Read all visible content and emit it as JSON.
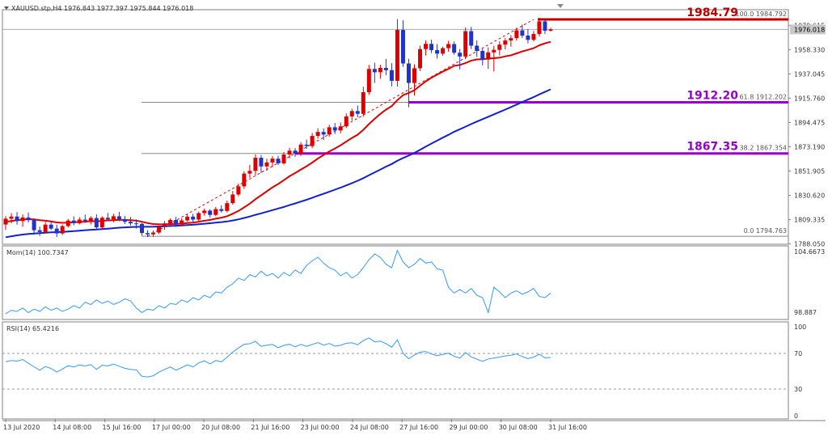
{
  "price_panel": {
    "title": "XAUUSD.stp,H4  1976.843 1977.397 1975.844 1976.018",
    "price_ticks": [
      "1979.615",
      "1958.330",
      "1937.045",
      "1915.760",
      "1894.475",
      "1873.190",
      "1851.905",
      "1830.620",
      "1809.335",
      "1788.050"
    ],
    "current_price": "1976.018",
    "fib": [
      {
        "label": "100.0 1984.792",
        "price": 1984.79,
        "big_label": "1984.79",
        "color": "#c00000"
      },
      {
        "label": "61.8 1912.202",
        "price": 1912.2,
        "big_label": "1912.20",
        "color": "#9900cc"
      },
      {
        "label": "38.2 1867.354",
        "price": 1867.35,
        "big_label": "1867.35",
        "color": "#9900cc"
      },
      {
        "label": "0.0 1794.763",
        "price": 1794.76,
        "big_label": "",
        "color": "#888888"
      }
    ]
  },
  "mom_panel": {
    "title": "Mom(14) 100.7347",
    "ticks": [
      "104.6673",
      "98.887"
    ]
  },
  "rsi_panel": {
    "title": "RSI(14) 65.4216",
    "ticks": [
      "100",
      "70",
      "30",
      "0"
    ]
  },
  "time_axis": [
    "13 Jul 2020",
    "14 Jul 08:00",
    "15 Jul 16:00",
    "17 Jul 00:00",
    "20 Jul 08:00",
    "21 Jul 16:00",
    "23 Jul 00:00",
    "24 Jul 08:00",
    "27 Jul 16:00",
    "29 Jul 00:00",
    "30 Jul 08:00",
    "31 Jul 16:00"
  ],
  "colors": {
    "bull": "#2233cc",
    "bear": "#dd0000",
    "ma_fast": "#dd0000",
    "ma_slow": "#1122cc",
    "osc": "#3399ff",
    "grid": "#9a9a9a"
  },
  "chart_data": [
    {
      "type": "candlestick",
      "title": "XAUUSD.stp,H4",
      "ylim": [
        1787.8,
        1993.3
      ],
      "candles": [
        [
          1805.1,
          1812.5,
          1800.5,
          1810.2
        ],
        [
          1810.2,
          1815.1,
          1806.2,
          1812.1
        ],
        [
          1812.1,
          1816.0,
          1805.0,
          1808.1
        ],
        [
          1808.1,
          1814.0,
          1803.0,
          1811.3
        ],
        [
          1811.3,
          1815.6,
          1806.9,
          1809.0
        ],
        [
          1809.0,
          1810.5,
          1796.2,
          1800.1
        ],
        [
          1800.1,
          1803.3,
          1795.1,
          1798.5
        ],
        [
          1798.5,
          1807.4,
          1797.5,
          1805.0
        ],
        [
          1805.0,
          1808.0,
          1800.2,
          1801.5
        ],
        [
          1801.5,
          1805.0,
          1794.1,
          1797.3
        ],
        [
          1797.3,
          1805.1,
          1796.0,
          1803.7
        ],
        [
          1803.7,
          1810.1,
          1802.5,
          1808.6
        ],
        [
          1808.6,
          1812.2,
          1804.3,
          1806.2
        ],
        [
          1806.2,
          1811.5,
          1805.1,
          1809.4
        ],
        [
          1809.4,
          1813.7,
          1806.5,
          1808.2
        ],
        [
          1808.2,
          1812.4,
          1805.1,
          1810.8
        ],
        [
          1810.8,
          1814.1,
          1800.1,
          1802.6
        ],
        [
          1802.6,
          1812.3,
          1801.5,
          1811.0
        ],
        [
          1811.0,
          1815.2,
          1808.4,
          1809.6
        ],
        [
          1809.6,
          1814.5,
          1807.1,
          1812.3
        ],
        [
          1812.3,
          1816.2,
          1808.0,
          1809.8
        ],
        [
          1809.8,
          1812.5,
          1805.5,
          1807.5
        ],
        [
          1807.5,
          1811.7,
          1804.2,
          1806.1
        ],
        [
          1806.1,
          1809.5,
          1801.5,
          1805.7
        ],
        [
          1805.7,
          1806.5,
          1795.3,
          1797.6
        ],
        [
          1797.6,
          1800.2,
          1794.1,
          1796.5
        ],
        [
          1796.5,
          1799.7,
          1794.2,
          1798.1
        ],
        [
          1798.1,
          1804.3,
          1796.8,
          1802.9
        ],
        [
          1802.9,
          1808.1,
          1800.5,
          1806.0
        ],
        [
          1806.0,
          1810.6,
          1804.2,
          1809.1
        ],
        [
          1809.1,
          1811.8,
          1803.0,
          1805.2
        ],
        [
          1805.2,
          1810.5,
          1804.0,
          1808.7
        ],
        [
          1808.7,
          1813.9,
          1807.5,
          1812.0
        ],
        [
          1812.0,
          1814.5,
          1807.4,
          1809.4
        ],
        [
          1809.4,
          1816.5,
          1808.0,
          1815.1
        ],
        [
          1815.1,
          1819.0,
          1812.8,
          1817.3
        ],
        [
          1817.3,
          1818.5,
          1811.1,
          1813.5
        ],
        [
          1813.5,
          1820.5,
          1812.4,
          1818.6
        ],
        [
          1818.6,
          1822.0,
          1815.5,
          1817.0
        ],
        [
          1817.0,
          1826.1,
          1815.8,
          1823.8
        ],
        [
          1823.8,
          1834.5,
          1822.5,
          1831.4
        ],
        [
          1831.4,
          1841.0,
          1829.9,
          1838.5
        ],
        [
          1838.5,
          1851.8,
          1836.2,
          1849.7
        ],
        [
          1849.7,
          1857.4,
          1846.1,
          1852.1
        ],
        [
          1852.1,
          1866.5,
          1848.3,
          1863.6
        ],
        [
          1863.6,
          1866.0,
          1850.3,
          1856.0
        ],
        [
          1856.0,
          1862.7,
          1852.1,
          1859.5
        ],
        [
          1859.5,
          1865.1,
          1855.4,
          1862.8
        ],
        [
          1862.8,
          1865.3,
          1857.2,
          1858.7
        ],
        [
          1858.7,
          1868.5,
          1857.5,
          1866.4
        ],
        [
          1866.4,
          1872.4,
          1863.1,
          1869.8
        ],
        [
          1869.8,
          1872.0,
          1864.4,
          1867.2
        ],
        [
          1867.2,
          1877.3,
          1865.2,
          1875.1
        ],
        [
          1875.1,
          1879.6,
          1871.4,
          1873.8
        ],
        [
          1873.8,
          1885.2,
          1872.1,
          1882.7
        ],
        [
          1882.7,
          1889.5,
          1880.4,
          1886.2
        ],
        [
          1886.2,
          1889.4,
          1879.1,
          1883.9
        ],
        [
          1883.9,
          1892.5,
          1882.0,
          1890.3
        ],
        [
          1890.3,
          1894.0,
          1884.5,
          1887.5
        ],
        [
          1887.5,
          1894.5,
          1885.0,
          1891.1
        ],
        [
          1891.1,
          1902.4,
          1889.6,
          1899.8
        ],
        [
          1899.8,
          1906.6,
          1896.2,
          1904.5
        ],
        [
          1904.5,
          1909.4,
          1899.0,
          1902.1
        ],
        [
          1902.1,
          1925.8,
          1899.5,
          1921.0
        ],
        [
          1921.0,
          1945.0,
          1918.6,
          1941.4
        ],
        [
          1941.4,
          1946.9,
          1929.1,
          1938.5
        ],
        [
          1938.5,
          1945.1,
          1932.8,
          1942.3
        ],
        [
          1942.3,
          1950.2,
          1936.0,
          1940.3
        ],
        [
          1940.3,
          1946.5,
          1926.1,
          1931.0
        ],
        [
          1931.0,
          1985.1,
          1926.0,
          1975.6
        ],
        [
          1975.6,
          1984.0,
          1943.2,
          1946.2
        ],
        [
          1946.2,
          1950.3,
          1907.8,
          1929.1
        ],
        [
          1929.1,
          1945.5,
          1918.0,
          1942.0
        ],
        [
          1942.0,
          1961.8,
          1939.5,
          1958.8
        ],
        [
          1958.8,
          1966.4,
          1953.1,
          1963.4
        ],
        [
          1963.4,
          1967.0,
          1955.3,
          1957.9
        ],
        [
          1957.9,
          1963.2,
          1950.5,
          1954.8
        ],
        [
          1954.8,
          1960.9,
          1953.0,
          1959.6
        ],
        [
          1959.6,
          1966.1,
          1956.5,
          1963.2
        ],
        [
          1963.2,
          1965.5,
          1953.8,
          1955.6
        ],
        [
          1955.6,
          1958.9,
          1940.9,
          1952.3
        ],
        [
          1952.3,
          1977.7,
          1950.0,
          1974.5
        ],
        [
          1974.5,
          1978.2,
          1958.8,
          1961.8
        ],
        [
          1961.8,
          1966.5,
          1952.1,
          1957.2
        ],
        [
          1957.2,
          1959.0,
          1944.5,
          1949.6
        ],
        [
          1949.6,
          1960.3,
          1941.5,
          1955.9
        ],
        [
          1955.9,
          1961.6,
          1939.1,
          1958.1
        ],
        [
          1958.1,
          1965.6,
          1953.2,
          1962.7
        ],
        [
          1962.7,
          1968.4,
          1958.6,
          1966.3
        ],
        [
          1966.3,
          1971.0,
          1960.9,
          1968.4
        ],
        [
          1968.4,
          1977.5,
          1966.2,
          1975.2
        ],
        [
          1975.2,
          1980.3,
          1968.5,
          1970.6
        ],
        [
          1970.6,
          1976.4,
          1963.8,
          1966.9
        ],
        [
          1966.9,
          1974.7,
          1965.5,
          1972.0
        ],
        [
          1972.0,
          1986.2,
          1969.9,
          1983.1
        ],
        [
          1983.1,
          1984.8,
          1972.1,
          1974.9
        ],
        [
          1974.9,
          1977.4,
          1974.3,
          1976.0
        ]
      ],
      "ma_fast": [
        1807.5,
        1808.2,
        1808.9,
        1809.4,
        1809.8,
        1809.6,
        1808.9,
        1808.4,
        1807.8,
        1806.9,
        1806.6,
        1806.7,
        1807.0,
        1807.4,
        1807.6,
        1808.1,
        1807.9,
        1808.3,
        1808.7,
        1808.9,
        1809.2,
        1809.1,
        1808.9,
        1808.5,
        1807.5,
        1806.4,
        1805.5,
        1805.3,
        1805.2,
        1805.5,
        1805.6,
        1805.9,
        1806.4,
        1806.8,
        1807.5,
        1808.4,
        1809.1,
        1810.2,
        1811.1,
        1812.4,
        1814.5,
        1817.0,
        1820.1,
        1823.4,
        1827.3,
        1830.7,
        1834.2,
        1837.7,
        1840.6,
        1843.9,
        1847.4,
        1850.2,
        1853.3,
        1856.2,
        1859.4,
        1862.9,
        1866.0,
        1869.1,
        1871.7,
        1874.5,
        1877.8,
        1881.0,
        1883.8,
        1888.1,
        1893.1,
        1897.7,
        1902.0,
        1905.8,
        1908.8,
        1914.1,
        1918.5,
        1920.4,
        1922.8,
        1926.7,
        1930.5,
        1933.8,
        1936.4,
        1939.1,
        1941.4,
        1944.1,
        1944.9,
        1946.5,
        1948.7,
        1949.7,
        1949.9,
        1950.5,
        1950.8,
        1951.3,
        1952.4,
        1953.3,
        1955.0,
        1956.7,
        1958.1,
        1959.6,
        1962.1,
        1963.9,
        1965.1
      ],
      "ma_slow": [
        1794.0,
        1794.8,
        1795.6,
        1796.3,
        1796.9,
        1797.2,
        1797.5,
        1797.9,
        1798.2,
        1798.4,
        1798.6,
        1798.9,
        1799.3,
        1799.7,
        1800.1,
        1800.5,
        1800.7,
        1801.1,
        1801.5,
        1801.9,
        1802.3,
        1802.6,
        1802.8,
        1803.0,
        1803.1,
        1803.1,
        1803.2,
        1803.4,
        1803.6,
        1803.8,
        1804.0,
        1804.3,
        1804.6,
        1804.9,
        1805.3,
        1805.8,
        1806.2,
        1806.7,
        1807.2,
        1807.8,
        1808.6,
        1809.6,
        1810.8,
        1812.1,
        1813.6,
        1814.9,
        1816.3,
        1817.7,
        1819.1,
        1820.5,
        1822.1,
        1823.6,
        1825.2,
        1826.8,
        1828.5,
        1830.3,
        1832.0,
        1833.8,
        1835.6,
        1837.4,
        1839.4,
        1841.4,
        1843.4,
        1845.7,
        1848.3,
        1850.8,
        1853.3,
        1855.8,
        1858.1,
        1861.0,
        1863.4,
        1865.5,
        1867.9,
        1870.6,
        1873.4,
        1876.0,
        1878.6,
        1881.2,
        1883.7,
        1886.4,
        1888.6,
        1890.8,
        1893.1,
        1895.3,
        1897.4,
        1899.5,
        1901.6,
        1903.7,
        1905.8,
        1908.0,
        1910.2,
        1912.4,
        1914.6,
        1916.7,
        1919.1,
        1921.3,
        1923.5
      ],
      "fib_levels": [
        {
          "ratio": 100.0,
          "price": 1984.792
        },
        {
          "ratio": 61.8,
          "price": 1912.202
        },
        {
          "ratio": 38.2,
          "price": 1867.354
        },
        {
          "ratio": 0.0,
          "price": 1794.763
        }
      ]
    },
    {
      "type": "line",
      "title": "Mom(14)",
      "ylim": [
        98.6,
        105.0
      ],
      "values": [
        99.1,
        99.4,
        99.3,
        99.6,
        99.2,
        99.5,
        99.3,
        99.7,
        99.4,
        99.6,
        99.3,
        99.5,
        99.8,
        99.6,
        100.1,
        99.9,
        100.3,
        100.0,
        100.2,
        99.9,
        100.1,
        100.4,
        100.2,
        99.6,
        99.2,
        99.5,
        99.4,
        99.8,
        99.6,
        100.0,
        99.9,
        100.3,
        100.1,
        100.5,
        100.3,
        100.7,
        100.5,
        101.0,
        100.9,
        101.4,
        101.7,
        102.2,
        102.0,
        102.5,
        102.3,
        102.8,
        102.4,
        102.6,
        102.2,
        102.7,
        102.4,
        102.9,
        102.6,
        103.3,
        103.7,
        104.0,
        103.5,
        103.1,
        102.9,
        102.4,
        102.7,
        102.2,
        102.5,
        103.1,
        103.8,
        104.3,
        104.0,
        103.4,
        103.1,
        104.6,
        103.6,
        103.1,
        103.4,
        103.9,
        103.5,
        103.6,
        103.0,
        102.9,
        101.4,
        100.9,
        101.2,
        100.9,
        101.3,
        100.7,
        100.5,
        99.2,
        101.4,
        101.0,
        100.5,
        100.9,
        101.1,
        100.8,
        101.0,
        101.3,
        100.6,
        100.5,
        100.9
      ]
    },
    {
      "type": "line",
      "title": "RSI(14)",
      "ylim": [
        0,
        100
      ],
      "values": [
        60.5,
        62.1,
        61.5,
        63.2,
        58.9,
        55.0,
        51.2,
        55.3,
        53.1,
        49.2,
        52.5,
        56.2,
        54.8,
        57.1,
        55.9,
        57.5,
        52.1,
        56.8,
        55.9,
        58.0,
        55.6,
        53.3,
        52.0,
        51.6,
        44.3,
        43.5,
        44.9,
        49.0,
        52.0,
        54.8,
        51.2,
        54.1,
        57.3,
        54.9,
        59.4,
        61.7,
        58.3,
        62.1,
        60.5,
        65.8,
        71.5,
        76.2,
        80.3,
        81.0,
        83.6,
        78.0,
        79.3,
        80.2,
        76.5,
        79.1,
        80.3,
        77.5,
        80.2,
        78.0,
        80.1,
        82.3,
        79.4,
        81.3,
        78.2,
        79.2,
        81.5,
        82.0,
        79.8,
        84.4,
        87.5,
        83.0,
        83.8,
        81.1,
        77.0,
        85.4,
        70.1,
        64.1,
        68.3,
        71.5,
        72.2,
        69.5,
        67.5,
        69.0,
        70.3,
        66.8,
        64.8,
        71.0,
        66.2,
        63.5,
        61.2,
        63.8,
        64.7,
        66.0,
        67.2,
        67.9,
        69.5,
        66.5,
        64.3,
        65.9,
        69.1,
        65.1,
        65.4
      ]
    }
  ]
}
